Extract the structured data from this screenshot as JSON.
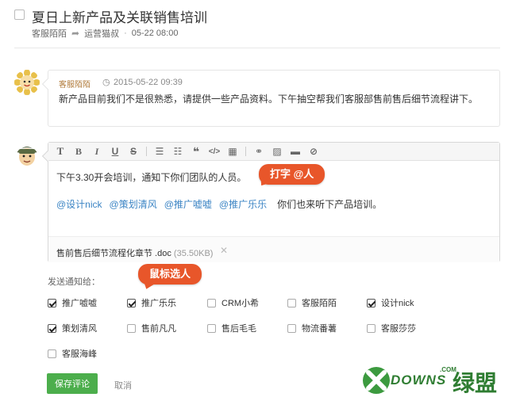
{
  "header": {
    "title": "夏日上新产品及关联销售培训",
    "author": "客服陌陌",
    "assignee": "运营猫叔",
    "separator": "·",
    "time": "05-22 08:00"
  },
  "comment": {
    "author": "客服陌陌",
    "time": "2015-05-22 09:39",
    "content": "新产品目前我们不是很熟悉，请提供一些产品资料。下午抽空帮我们客服部售前售后细节流程讲下。"
  },
  "editor": {
    "toolbar": [
      "bold-T",
      "bold",
      "italic",
      "underline",
      "strikethrough",
      "ordered-list",
      "unordered-list",
      "quote",
      "code",
      "table",
      "link",
      "image",
      "horizontal-rule",
      "attachment"
    ],
    "line1": "下午3.30开会培训，通知下你们团队的人员。",
    "mentions": [
      "@设计nick",
      "@策划清风",
      "@推广嘘嘘",
      "@推广乐乐"
    ],
    "line2_tail": "你们也来听下产品培训。",
    "attachment": {
      "name": "售前售后细节流程化章节 .doc",
      "size": "(35.50KB)",
      "remove": "✕"
    }
  },
  "callouts": {
    "typing": "打字 @人",
    "mouse": "鼠标选人"
  },
  "notify": {
    "label": "发送通知给：",
    "people": [
      {
        "name": "推广嘘嘘",
        "checked": true
      },
      {
        "name": "推广乐乐",
        "checked": true
      },
      {
        "name": "CRM小希",
        "checked": false
      },
      {
        "name": "客服陌陌",
        "checked": false
      },
      {
        "name": "设计nick",
        "checked": true
      },
      {
        "name": "策划清风",
        "checked": true
      },
      {
        "name": "售前凡凡",
        "checked": false
      },
      {
        "name": "售后毛毛",
        "checked": false
      },
      {
        "name": "物流番薯",
        "checked": false
      },
      {
        "name": "客服莎莎",
        "checked": false
      },
      {
        "name": "客服海峰",
        "checked": false
      }
    ]
  },
  "actions": {
    "save": "保存评论",
    "cancel": "取消"
  },
  "watermark": {
    "brand": "DOWNS",
    "com": ".COM",
    "cn": "绿盟"
  },
  "colors": {
    "accent_green": "#4cae4c",
    "mention_blue": "#3b84c4",
    "callout_orange": "#e8562a",
    "author_brown": "#b07a3a"
  }
}
